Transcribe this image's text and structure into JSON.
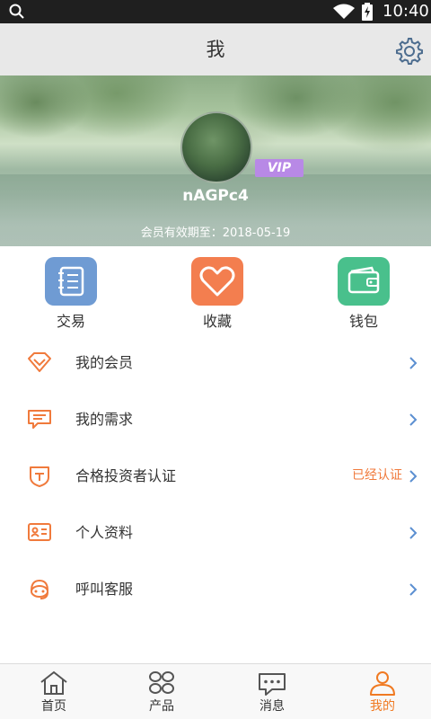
{
  "status_bar": {
    "time": "10:40"
  },
  "header": {
    "title": "我"
  },
  "profile": {
    "username": "nAGPc4",
    "vip_label": "VIP",
    "expire_label": "会员有效期至：",
    "expire_date": "2018-05-19"
  },
  "quick_actions": [
    {
      "label": "交易",
      "icon": "ledger-icon",
      "color": "#6f9bd3"
    },
    {
      "label": "收藏",
      "icon": "heart-icon",
      "color": "#f37e4f"
    },
    {
      "label": "钱包",
      "icon": "wallet-icon",
      "color": "#49c08c"
    }
  ],
  "menu": [
    {
      "label": "我的会员",
      "icon": "diamond-icon",
      "status": ""
    },
    {
      "label": "我的需求",
      "icon": "message-icon",
      "status": ""
    },
    {
      "label": "合格投资者认证",
      "icon": "certificate-icon",
      "status": "已经认证"
    },
    {
      "label": "个人资料",
      "icon": "id-card-icon",
      "status": ""
    },
    {
      "label": "呼叫客服",
      "icon": "headset-icon",
      "status": ""
    }
  ],
  "tabs": [
    {
      "label": "首页",
      "icon": "home-icon",
      "active": false
    },
    {
      "label": "产品",
      "icon": "grid-icon",
      "active": false
    },
    {
      "label": "消息",
      "icon": "chat-icon",
      "active": false
    },
    {
      "label": "我的",
      "icon": "user-icon",
      "active": true
    }
  ],
  "colors": {
    "accent": "#f07a22",
    "chevron": "#5b8fd1",
    "menu_icon": "#f07a3c"
  }
}
